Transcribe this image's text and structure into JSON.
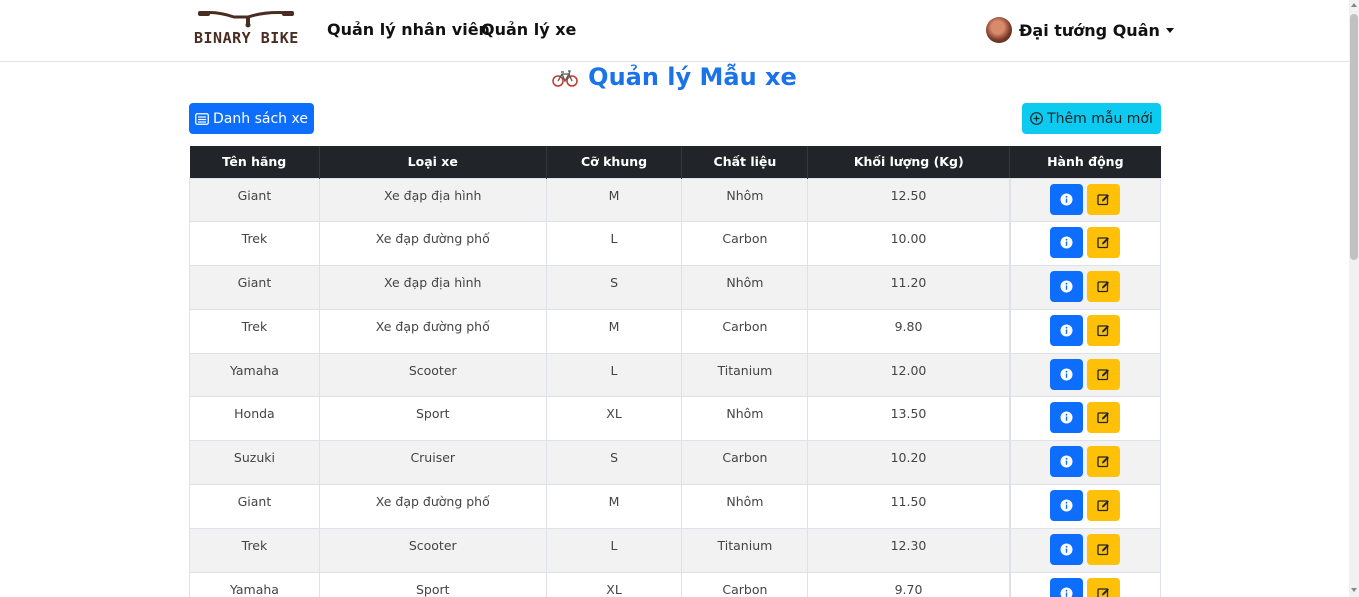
{
  "brand": {
    "name": "BINARY BIKE"
  },
  "nav": {
    "items": [
      "Quản lý nhân viên",
      "Quản lý xe"
    ]
  },
  "user": {
    "name": "Đại tướng Quân"
  },
  "page": {
    "title": "Quản lý Mẫu xe"
  },
  "toolbar": {
    "list_label": "Danh sách xe",
    "add_label": "Thêm mẫu mới"
  },
  "table": {
    "headers": [
      "Tên hãng",
      "Loại xe",
      "Cỡ khung",
      "Chất liệu",
      "Khối lượng (Kg)",
      "Hành động"
    ],
    "rows": [
      [
        "Giant",
        "Xe đạp địa hình",
        "M",
        "Nhôm",
        "12.50"
      ],
      [
        "Trek",
        "Xe đạp đường phố",
        "L",
        "Carbon",
        "10.00"
      ],
      [
        "Giant",
        "Xe đạp địa hình",
        "S",
        "Nhôm",
        "11.20"
      ],
      [
        "Trek",
        "Xe đạp đường phố",
        "M",
        "Carbon",
        "9.80"
      ],
      [
        "Yamaha",
        "Scooter",
        "L",
        "Titanium",
        "12.00"
      ],
      [
        "Honda",
        "Sport",
        "XL",
        "Nhôm",
        "13.50"
      ],
      [
        "Suzuki",
        "Cruiser",
        "S",
        "Carbon",
        "10.20"
      ],
      [
        "Giant",
        "Xe đạp đường phố",
        "M",
        "Nhôm",
        "11.50"
      ],
      [
        "Trek",
        "Scooter",
        "L",
        "Titanium",
        "12.30"
      ],
      [
        "Yamaha",
        "Sport",
        "XL",
        "Carbon",
        "9.70"
      ]
    ]
  },
  "colors": {
    "primary": "#0d6efd",
    "info": "#0dcaf0",
    "warning": "#ffc107",
    "title": "#1a73e8",
    "header_dark": "#212529"
  },
  "icons": {
    "info_button": "info-circle-icon",
    "edit_button": "pencil-square-icon",
    "list_button": "list-icon",
    "add_button": "plus-circle-icon",
    "title": "bicycle-icon"
  }
}
